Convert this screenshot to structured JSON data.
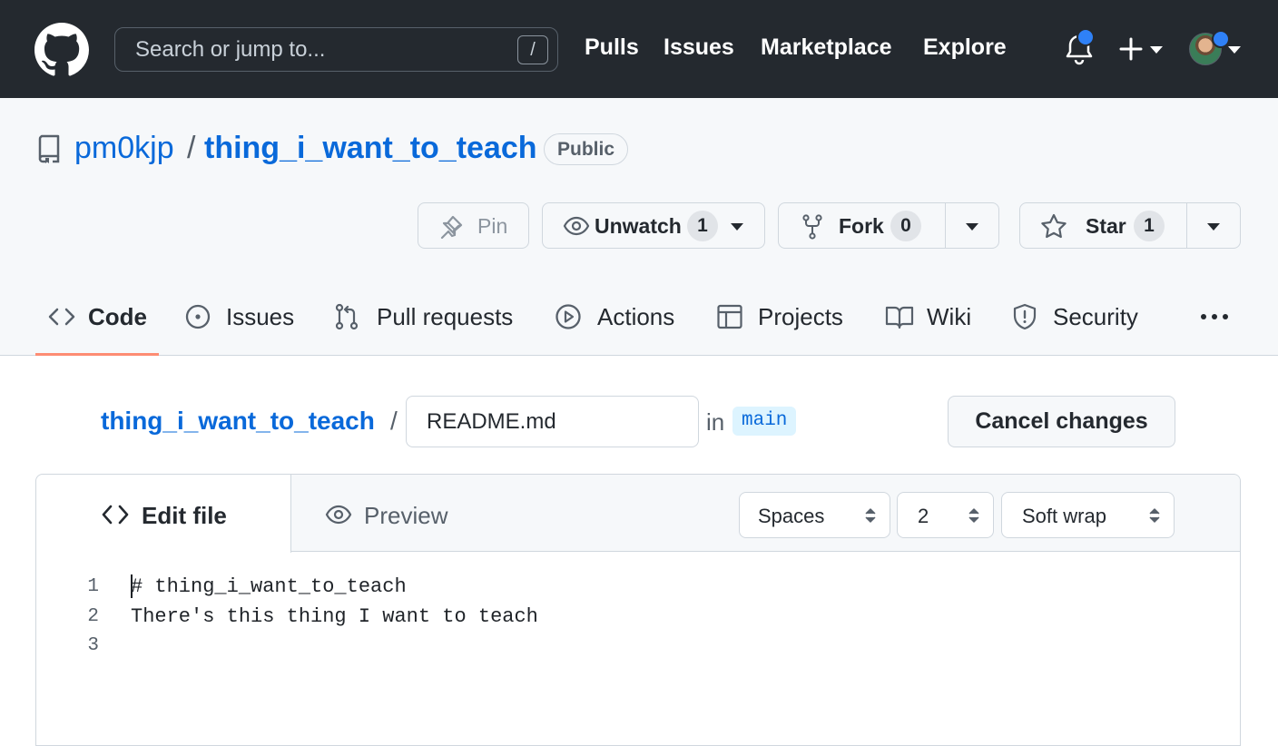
{
  "header": {
    "search_placeholder": "Search or jump to...",
    "search_key": "/",
    "nav": [
      "Pulls",
      "Issues",
      "Marketplace",
      "Explore"
    ],
    "accent_color": "#2f81f7"
  },
  "repo": {
    "owner": "pm0kjp",
    "separator": "/",
    "name": "thing_i_want_to_teach",
    "visibility": "Public",
    "pin_label": "Pin",
    "unwatch_label": "Unwatch",
    "watch_count": "1",
    "fork_label": "Fork",
    "fork_count": "0",
    "star_label": "Star",
    "star_count": "1"
  },
  "tabs": [
    "Code",
    "Issues",
    "Pull requests",
    "Actions",
    "Projects",
    "Wiki",
    "Security"
  ],
  "editor": {
    "breadcrumb_repo": "thing_i_want_to_teach",
    "breadcrumb_sep": "/",
    "filename": "README.md",
    "in_label": "in",
    "branch": "main",
    "cancel_label": "Cancel changes",
    "edit_tab": "Edit file",
    "preview_tab": "Preview",
    "indent_mode": "Spaces",
    "indent_size": "2",
    "wrap_mode": "Soft wrap",
    "line_numbers": [
      "1",
      "2",
      "3"
    ],
    "lines": [
      "# thing_i_want_to_teach",
      "There's this thing I want to teach",
      ""
    ]
  }
}
